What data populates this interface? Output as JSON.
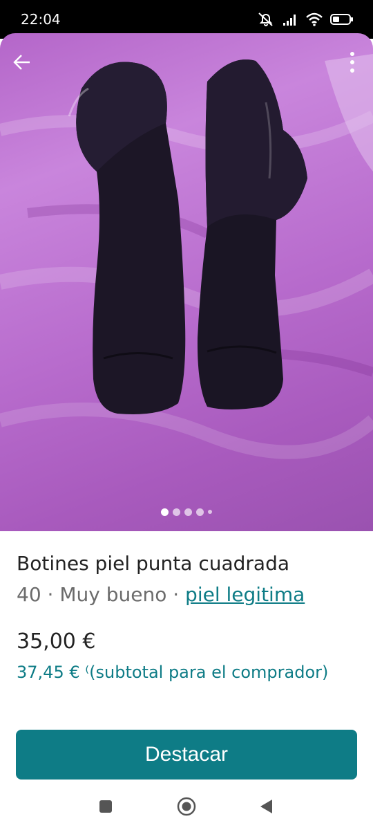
{
  "status_bar": {
    "time": "22:04",
    "icons": [
      "mute-icon",
      "signal-icon",
      "wifi-icon",
      "battery-icon"
    ]
  },
  "photo": {
    "description_icon": "boots-photo",
    "pager": {
      "count": 5,
      "active_index": 0
    }
  },
  "listing": {
    "title": "Botines piel punta cuadrada",
    "size": "40",
    "separator1": " · ",
    "condition": "Muy bueno",
    "separator2": " · ",
    "tag_link": "piel legitima",
    "price": "35,00 €",
    "subtotal": "37,45 € ⁽(subtotal para el comprador)"
  },
  "actions": {
    "feature_button": "Destacar"
  },
  "colors": {
    "accent": "#0e7c86",
    "text": "#222222",
    "muted": "#6b6b6b"
  }
}
